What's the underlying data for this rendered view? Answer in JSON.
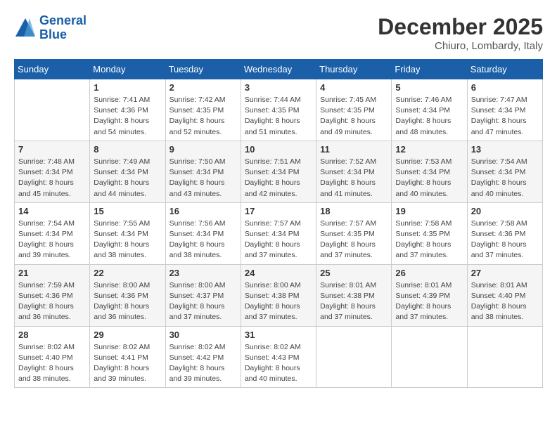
{
  "header": {
    "logo_line1": "General",
    "logo_line2": "Blue",
    "month": "December 2025",
    "location": "Chiuro, Lombardy, Italy"
  },
  "weekdays": [
    "Sunday",
    "Monday",
    "Tuesday",
    "Wednesday",
    "Thursday",
    "Friday",
    "Saturday"
  ],
  "weeks": [
    [
      {
        "day": "",
        "sunrise": "",
        "sunset": "",
        "daylight": ""
      },
      {
        "day": "1",
        "sunrise": "Sunrise: 7:41 AM",
        "sunset": "Sunset: 4:36 PM",
        "daylight": "Daylight: 8 hours and 54 minutes."
      },
      {
        "day": "2",
        "sunrise": "Sunrise: 7:42 AM",
        "sunset": "Sunset: 4:35 PM",
        "daylight": "Daylight: 8 hours and 52 minutes."
      },
      {
        "day": "3",
        "sunrise": "Sunrise: 7:44 AM",
        "sunset": "Sunset: 4:35 PM",
        "daylight": "Daylight: 8 hours and 51 minutes."
      },
      {
        "day": "4",
        "sunrise": "Sunrise: 7:45 AM",
        "sunset": "Sunset: 4:35 PM",
        "daylight": "Daylight: 8 hours and 49 minutes."
      },
      {
        "day": "5",
        "sunrise": "Sunrise: 7:46 AM",
        "sunset": "Sunset: 4:34 PM",
        "daylight": "Daylight: 8 hours and 48 minutes."
      },
      {
        "day": "6",
        "sunrise": "Sunrise: 7:47 AM",
        "sunset": "Sunset: 4:34 PM",
        "daylight": "Daylight: 8 hours and 47 minutes."
      }
    ],
    [
      {
        "day": "7",
        "sunrise": "Sunrise: 7:48 AM",
        "sunset": "Sunset: 4:34 PM",
        "daylight": "Daylight: 8 hours and 45 minutes."
      },
      {
        "day": "8",
        "sunrise": "Sunrise: 7:49 AM",
        "sunset": "Sunset: 4:34 PM",
        "daylight": "Daylight: 8 hours and 44 minutes."
      },
      {
        "day": "9",
        "sunrise": "Sunrise: 7:50 AM",
        "sunset": "Sunset: 4:34 PM",
        "daylight": "Daylight: 8 hours and 43 minutes."
      },
      {
        "day": "10",
        "sunrise": "Sunrise: 7:51 AM",
        "sunset": "Sunset: 4:34 PM",
        "daylight": "Daylight: 8 hours and 42 minutes."
      },
      {
        "day": "11",
        "sunrise": "Sunrise: 7:52 AM",
        "sunset": "Sunset: 4:34 PM",
        "daylight": "Daylight: 8 hours and 41 minutes."
      },
      {
        "day": "12",
        "sunrise": "Sunrise: 7:53 AM",
        "sunset": "Sunset: 4:34 PM",
        "daylight": "Daylight: 8 hours and 40 minutes."
      },
      {
        "day": "13",
        "sunrise": "Sunrise: 7:54 AM",
        "sunset": "Sunset: 4:34 PM",
        "daylight": "Daylight: 8 hours and 40 minutes."
      }
    ],
    [
      {
        "day": "14",
        "sunrise": "Sunrise: 7:54 AM",
        "sunset": "Sunset: 4:34 PM",
        "daylight": "Daylight: 8 hours and 39 minutes."
      },
      {
        "day": "15",
        "sunrise": "Sunrise: 7:55 AM",
        "sunset": "Sunset: 4:34 PM",
        "daylight": "Daylight: 8 hours and 38 minutes."
      },
      {
        "day": "16",
        "sunrise": "Sunrise: 7:56 AM",
        "sunset": "Sunset: 4:34 PM",
        "daylight": "Daylight: 8 hours and 38 minutes."
      },
      {
        "day": "17",
        "sunrise": "Sunrise: 7:57 AM",
        "sunset": "Sunset: 4:34 PM",
        "daylight": "Daylight: 8 hours and 37 minutes."
      },
      {
        "day": "18",
        "sunrise": "Sunrise: 7:57 AM",
        "sunset": "Sunset: 4:35 PM",
        "daylight": "Daylight: 8 hours and 37 minutes."
      },
      {
        "day": "19",
        "sunrise": "Sunrise: 7:58 AM",
        "sunset": "Sunset: 4:35 PM",
        "daylight": "Daylight: 8 hours and 37 minutes."
      },
      {
        "day": "20",
        "sunrise": "Sunrise: 7:58 AM",
        "sunset": "Sunset: 4:36 PM",
        "daylight": "Daylight: 8 hours and 37 minutes."
      }
    ],
    [
      {
        "day": "21",
        "sunrise": "Sunrise: 7:59 AM",
        "sunset": "Sunset: 4:36 PM",
        "daylight": "Daylight: 8 hours and 36 minutes."
      },
      {
        "day": "22",
        "sunrise": "Sunrise: 8:00 AM",
        "sunset": "Sunset: 4:36 PM",
        "daylight": "Daylight: 8 hours and 36 minutes."
      },
      {
        "day": "23",
        "sunrise": "Sunrise: 8:00 AM",
        "sunset": "Sunset: 4:37 PM",
        "daylight": "Daylight: 8 hours and 37 minutes."
      },
      {
        "day": "24",
        "sunrise": "Sunrise: 8:00 AM",
        "sunset": "Sunset: 4:38 PM",
        "daylight": "Daylight: 8 hours and 37 minutes."
      },
      {
        "day": "25",
        "sunrise": "Sunrise: 8:01 AM",
        "sunset": "Sunset: 4:38 PM",
        "daylight": "Daylight: 8 hours and 37 minutes."
      },
      {
        "day": "26",
        "sunrise": "Sunrise: 8:01 AM",
        "sunset": "Sunset: 4:39 PM",
        "daylight": "Daylight: 8 hours and 37 minutes."
      },
      {
        "day": "27",
        "sunrise": "Sunrise: 8:01 AM",
        "sunset": "Sunset: 4:40 PM",
        "daylight": "Daylight: 8 hours and 38 minutes."
      }
    ],
    [
      {
        "day": "28",
        "sunrise": "Sunrise: 8:02 AM",
        "sunset": "Sunset: 4:40 PM",
        "daylight": "Daylight: 8 hours and 38 minutes."
      },
      {
        "day": "29",
        "sunrise": "Sunrise: 8:02 AM",
        "sunset": "Sunset: 4:41 PM",
        "daylight": "Daylight: 8 hours and 39 minutes."
      },
      {
        "day": "30",
        "sunrise": "Sunrise: 8:02 AM",
        "sunset": "Sunset: 4:42 PM",
        "daylight": "Daylight: 8 hours and 39 minutes."
      },
      {
        "day": "31",
        "sunrise": "Sunrise: 8:02 AM",
        "sunset": "Sunset: 4:43 PM",
        "daylight": "Daylight: 8 hours and 40 minutes."
      },
      {
        "day": "",
        "sunrise": "",
        "sunset": "",
        "daylight": ""
      },
      {
        "day": "",
        "sunrise": "",
        "sunset": "",
        "daylight": ""
      },
      {
        "day": "",
        "sunrise": "",
        "sunset": "",
        "daylight": ""
      }
    ]
  ]
}
